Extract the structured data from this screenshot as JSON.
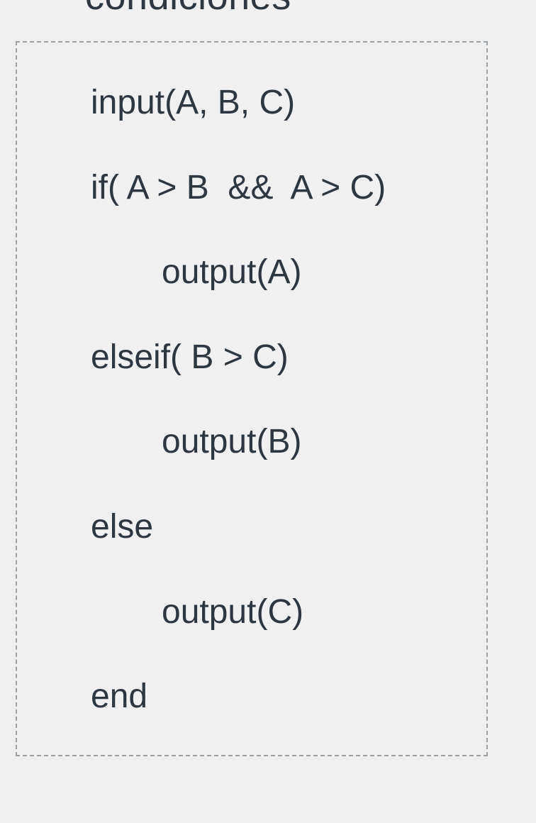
{
  "heading": "condiciones",
  "code": {
    "lines": [
      {
        "text": "input(A, B, C)",
        "indent": false
      },
      {
        "text": "if( A > B  &&  A > C)",
        "indent": false
      },
      {
        "text": "output(A)",
        "indent": true
      },
      {
        "text": "elseif( B > C)",
        "indent": false
      },
      {
        "text": "output(B)",
        "indent": true
      },
      {
        "text": "else",
        "indent": false
      },
      {
        "text": "output(C)",
        "indent": true
      },
      {
        "text": "end",
        "indent": false
      }
    ]
  }
}
